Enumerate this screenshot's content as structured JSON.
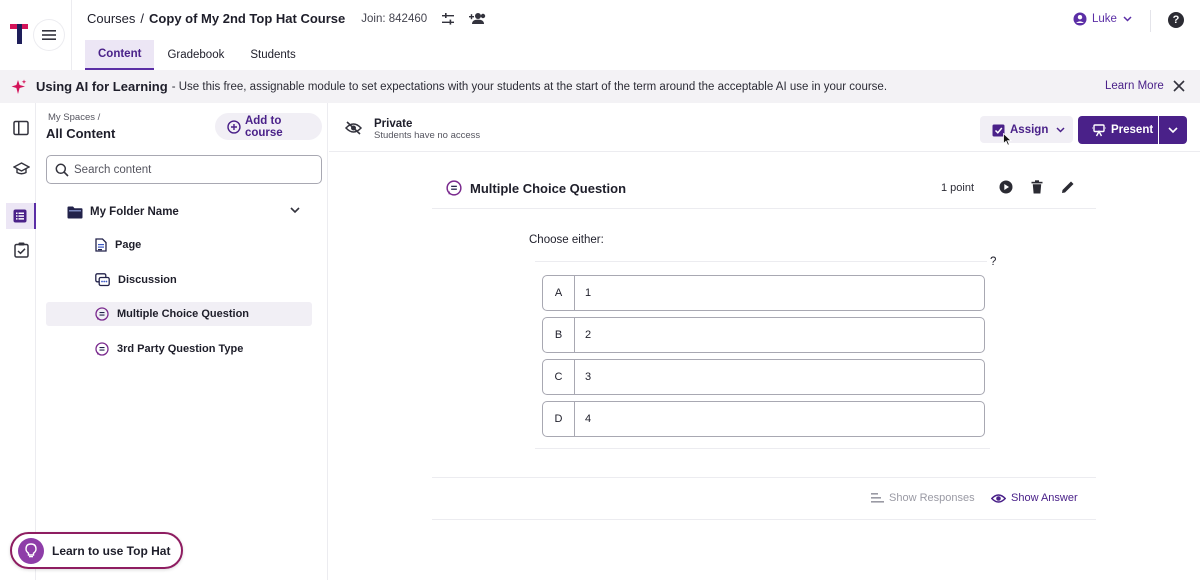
{
  "header": {
    "breadcrumb_root": "Courses",
    "breadcrumb_sep": "/",
    "course_title": "Copy of My 2nd Top Hat Course",
    "join_code": "Join: 842460",
    "user_name": "Luke",
    "help_label": "?"
  },
  "tabs": [
    {
      "label": "Content"
    },
    {
      "label": "Gradebook"
    },
    {
      "label": "Students"
    }
  ],
  "banner": {
    "title": "Using AI for Learning",
    "text": "- Use this free, assignable module to set expectations with your students at the start of the term around the acceptable AI use in your course.",
    "link": "Learn More"
  },
  "sidebar": {
    "breadcrumb": "My Spaces /",
    "title": "All Content",
    "add_button": "Add to course",
    "search_placeholder": "Search content",
    "folder_name": "My Folder Name",
    "items": [
      {
        "label": "Page"
      },
      {
        "label": "Discussion"
      },
      {
        "label": "Multiple Choice Question"
      },
      {
        "label": "3rd Party Question Type"
      }
    ],
    "learn_pill": "Learn to use Top Hat"
  },
  "main": {
    "privacy_title": "Private",
    "privacy_subtitle": "Students have no access",
    "assign_label": "Assign",
    "present_label": "Present",
    "question": {
      "title": "Multiple Choice Question",
      "points": "1 point",
      "prompt": "Choose either:",
      "help_mark": "?",
      "options": [
        {
          "letter": "A",
          "value": "1"
        },
        {
          "letter": "B",
          "value": "2"
        },
        {
          "letter": "C",
          "value": "3"
        },
        {
          "letter": "D",
          "value": "4"
        }
      ],
      "show_responses": "Show Responses",
      "show_answer": "Show Answer"
    }
  },
  "colors": {
    "brand_purple": "#4a2189",
    "accent_purple": "#5b2ea6",
    "active_tint": "#ece6f5",
    "logo_pink": "#d4145a",
    "pill_border": "#8e1d61"
  },
  "icons": [
    "tophat-logo-icon",
    "hamburger-icon",
    "sliders-icon",
    "add-people-icon",
    "user-circle-icon",
    "chevron-down-icon",
    "help-icon",
    "sparkle-icon",
    "close-icon",
    "panel-toggle-icon",
    "graduation-cap-icon",
    "list-icon",
    "checklist-icon",
    "plus-circle-icon",
    "search-icon",
    "folder-icon",
    "page-icon",
    "discussion-icon",
    "question-icon",
    "lightbulb-icon",
    "eye-off-icon",
    "assign-icon",
    "present-icon",
    "play-icon",
    "trash-icon",
    "pencil-icon",
    "bars-icon",
    "eye-icon",
    "cursor-icon"
  ]
}
